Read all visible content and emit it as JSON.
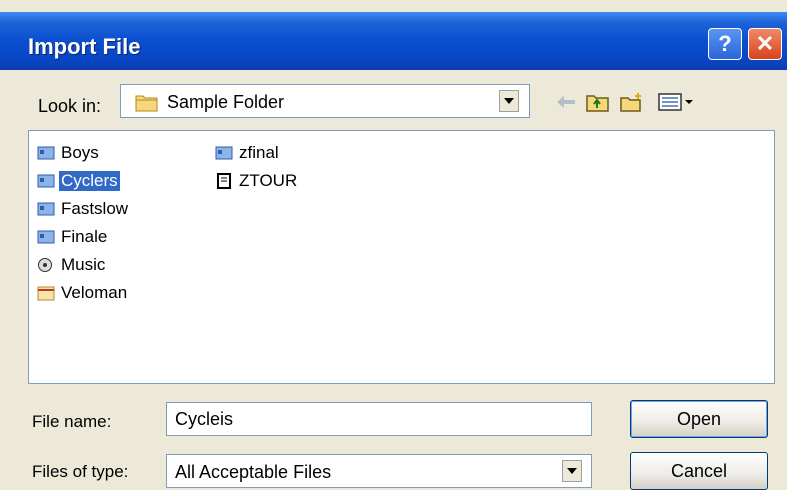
{
  "window": {
    "title": "Import File",
    "help_glyph": "?",
    "close_glyph": "✕"
  },
  "look_in": {
    "label": "Look in:",
    "value": "Sample Folder",
    "icon": "folder-icon"
  },
  "toolbar": {
    "buttons": [
      {
        "name": "back-button",
        "icon": "back-arrow-icon"
      },
      {
        "name": "up-folder-button",
        "icon": "up-folder-icon"
      },
      {
        "name": "new-folder-button",
        "icon": "new-folder-icon"
      },
      {
        "name": "view-menu-button",
        "icon": "view-menu-icon"
      }
    ]
  },
  "files": [
    {
      "name": "Boys",
      "icon": "media-file-icon",
      "selected": false
    },
    {
      "name": "Cyclers",
      "icon": "media-file-icon",
      "selected": true
    },
    {
      "name": "Fastslow",
      "icon": "media-file-icon",
      "selected": false
    },
    {
      "name": "Finale",
      "icon": "media-file-icon",
      "selected": false
    },
    {
      "name": "Music",
      "icon": "audio-file-icon",
      "selected": false
    },
    {
      "name": "Veloman",
      "icon": "project-file-icon",
      "selected": false
    },
    {
      "name": "zfinal",
      "icon": "media-file-icon",
      "selected": false
    },
    {
      "name": "ZTOUR",
      "icon": "document-file-icon",
      "selected": false
    }
  ],
  "file_name": {
    "label": "File name:",
    "value": "Cycleis"
  },
  "file_type": {
    "label": "Files of type:",
    "value": "All Acceptable Files"
  },
  "buttons": {
    "open": "Open",
    "cancel": "Cancel"
  },
  "colors": {
    "title_bar": "#0a4fd0",
    "selection": "#3169c6",
    "dialog_bg": "#ece9d8"
  }
}
